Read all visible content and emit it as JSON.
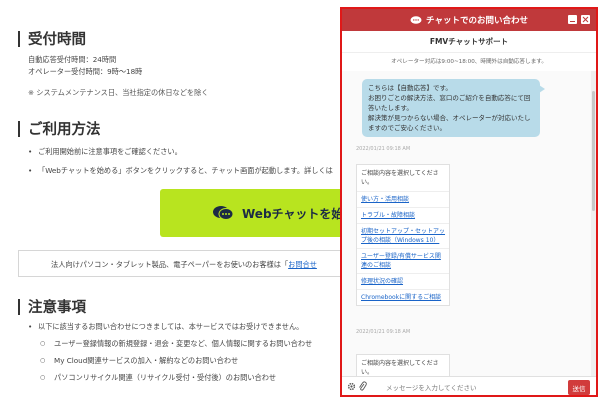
{
  "page": {
    "section1_title": "受付時間",
    "hours_auto": "自動応答受付時間：24時間",
    "hours_operator": "オペレーター受付時間：9時～18時",
    "maintenance_note": "※ システムメンテナンス日、当社指定の休日などを除く",
    "section2_title": "ご利用方法",
    "usage_items": [
      "ご利用開始前に注意事項をご確認ください。",
      "「Webチャットを始める」ボタンをクリックすると、チャット画面が起動します。詳しくは"
    ],
    "web_chat_button": "Webチャットを始め",
    "corporate_note": "法人向けパソコン・タブレット製品、電子ペーパーをお使いのお客様は「",
    "corporate_link": "お問合せ",
    "section3_title": "注意事項",
    "caution_intro": "以下に該当するお問い合わせにつきましては、本サービスではお受けできません。",
    "caution_items": [
      "ユーザー登録情報の新規登録・退会・変更など、個人情報に関するお問い合わせ",
      "My Cloud関連サービスの加入・解約などのお問い合わせ",
      "パソコンリサイクル関連（リサイクル受付・受付後）のお問い合わせ"
    ]
  },
  "chat": {
    "header_title": "チャットでのお問い合わせ",
    "subtitle": "FMVチャットサポート",
    "operator_hours": "オペレーター対応は9:00~18:00、時間外は自動応答します。",
    "operator_message": "こちらは【自動応答】です。\nお困りごとの解決方法、窓口のご紹介を自動応答にて回答いたします。\n解決策が見つからない場合、オペレーターが対応いたしますのでご安心ください。",
    "timestamp1": "2022/01/21 09:18 AM",
    "menu_question": "ご相談内容を選択してください。",
    "menu_options": [
      "使い方・活用相談",
      "トラブル・故障相談",
      "初期セットアップ・セットアップ後の相談（Windows 10）",
      "ユーザー登録/有償サービス関連のご相談",
      "修理状況の確認",
      "Chromebookに関するご相談"
    ],
    "timestamp2": "2022/01/21 09:18 AM",
    "menu_question2": "ご相談内容を選択してください。",
    "input_placeholder": "メッセージを入力してください",
    "send_label": "送信"
  },
  "colors": {
    "chat_header": "#c0393b",
    "highlight_border": "#e01818",
    "web_chat_button": "#b8e41f",
    "operator_bubble": "#b8dbe9",
    "link": "#1a64c8"
  },
  "icons": [
    "chat-bubble-icon",
    "minimize-icon",
    "close-icon",
    "gear-icon",
    "paperclip-icon"
  ]
}
